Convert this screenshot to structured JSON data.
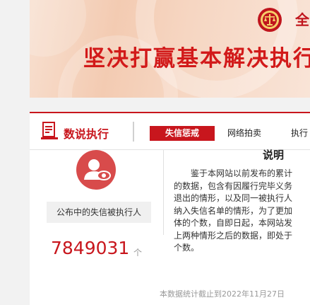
{
  "banner": {
    "org_text": "全",
    "slogan": "坚决打赢基本解决执行",
    "emblem_icon": "court-emblem-icon"
  },
  "nav": {
    "title": "数说执行",
    "icon": "document-chart-icon",
    "tabs": [
      {
        "label": "失信惩戒",
        "active": true
      },
      {
        "label": "网络拍卖",
        "active": false
      },
      {
        "label": "执行",
        "active": false
      }
    ]
  },
  "stats": {
    "avatar_icon": "person-eye-icon",
    "label": "公布中的失信被执行人",
    "count": "7849031",
    "unit": "个"
  },
  "note": {
    "title": "说明",
    "lines": [
      "　　鉴于本网站以前发布的累计",
      "的数据，包含有因履行完毕义务",
      "退出的情形，以及同一被执行人",
      "纳入失信名单的情形，为了更加",
      "体的个数，自即日起，本网站发",
      "上两种情形之后的数据，即处于",
      "个数。"
    ]
  },
  "footer": {
    "stat_date": "本数据统计截止到2022年11月27日"
  },
  "colors": {
    "brand_red": "#c8161d",
    "avatar_red": "#d84b4b",
    "banner_peach": "#f3cbb2"
  }
}
